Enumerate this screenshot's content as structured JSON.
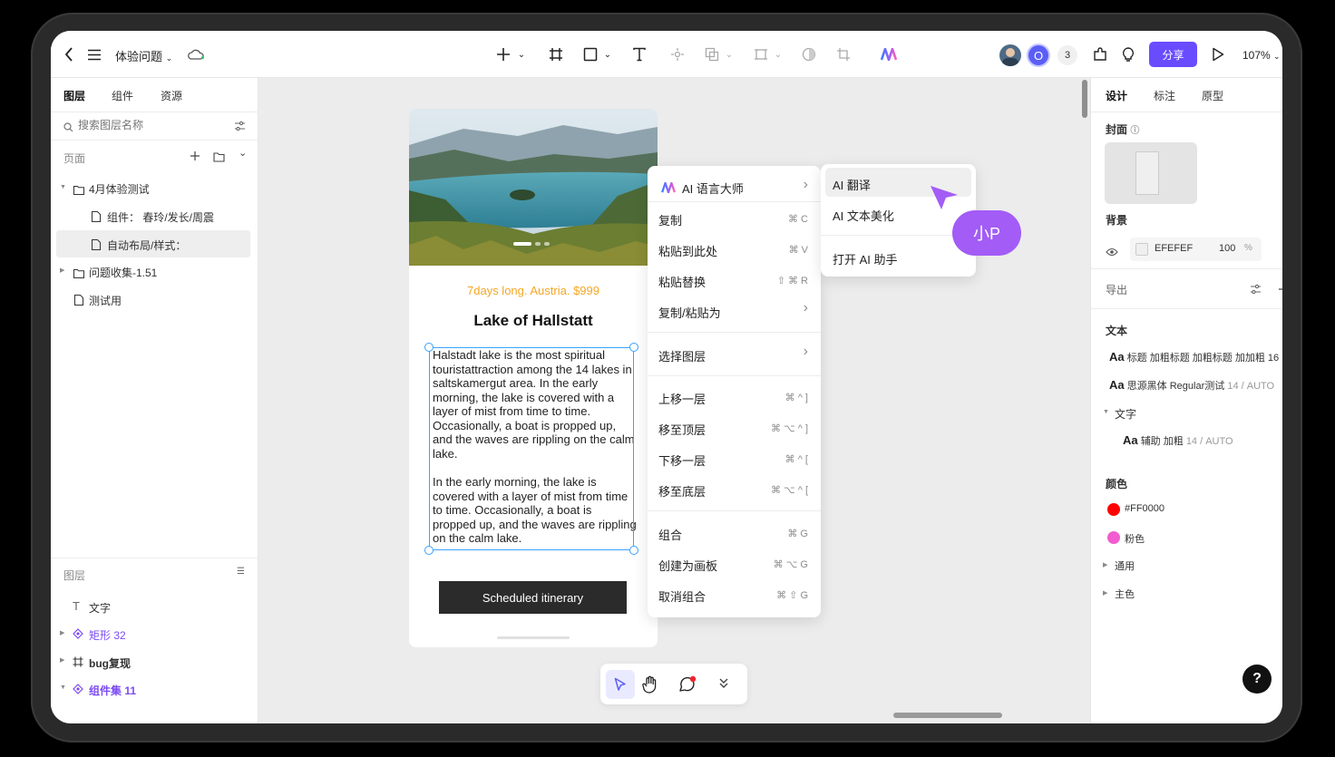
{
  "topbar": {
    "title": "体验问题",
    "collaborator_count": "3",
    "share_label": "分享",
    "zoom": "107%",
    "avatar_letter": "O"
  },
  "left_panel": {
    "tabs": [
      "图层",
      "组件",
      "资源"
    ],
    "search_placeholder": "搜索图层名称",
    "pages_label": "页面",
    "pages": [
      {
        "label": "4月体验测试"
      },
      {
        "label": "组件：  春玲/发长/周震"
      },
      {
        "label": "自动布局/样式："
      },
      {
        "label": "问题收集-1.51"
      },
      {
        "label": "测试用"
      }
    ],
    "layers_label": "图层",
    "layers": [
      {
        "label": "文字"
      },
      {
        "label": "矩形 32"
      },
      {
        "label": "bug复现"
      },
      {
        "label": "组件集 11"
      }
    ]
  },
  "right_panel": {
    "tabs": [
      "设计",
      "标注",
      "原型"
    ],
    "cover_label": "封面",
    "background_label": "背景",
    "background_hex": "EFEFEF",
    "background_opacity": "100",
    "percent": "%",
    "export_label": "导出",
    "text_label": "文本",
    "text_styles": [
      {
        "aa": "Aa",
        "label": "标题 加粗标题 加粗标题 加加粗 16"
      },
      {
        "aa": "Aa",
        "label": "思源黑体 Regular测试",
        "meta": "14 / AUTO"
      }
    ],
    "text_group": "文字",
    "text_sub": {
      "aa": "Aa",
      "label": "辅助 加粗",
      "meta": "14 / AUTO"
    },
    "color_label": "颜色",
    "colors": [
      {
        "label": "#FF0000",
        "hex": "#ff0000"
      },
      {
        "label": "粉色",
        "hex": "#f25ccf"
      }
    ],
    "color_groups": [
      "通用",
      "主色"
    ]
  },
  "card": {
    "subtitle": "7days long. Austria. $999",
    "title": "Lake of Hallstatt",
    "paragraph_1": "Halstadt lake is the most spiritual touristattraction among the 14 lakes in saltskamergut area. In the early morning, the lake is covered with a layer of mist from time to time. Occasionally, a boat is propped up, and the waves are rippling on the calm lake.",
    "paragraph_2": "In the early morning, the lake is covered with a layer of mist from time to time. Occasionally, a boat is propped up, and the waves are rippling on the calm lake.",
    "button_label": "Scheduled itinerary"
  },
  "context_menu": {
    "items": [
      {
        "label": "AI 语言大师",
        "shortcut": "›"
      },
      {
        "label": "复制",
        "shortcut": "⌘ C"
      },
      {
        "label": "粘贴到此处",
        "shortcut": "⌘ V"
      },
      {
        "label": "粘贴替换",
        "shortcut": "⇧ ⌘ R"
      },
      {
        "label": "复制/粘贴为",
        "shortcut": "›"
      },
      {
        "label": "选择图层",
        "shortcut": "›"
      },
      {
        "label": "上移一层",
        "shortcut": "⌘ ^ ]"
      },
      {
        "label": "移至顶层",
        "shortcut": "⌘ ⌥ ^ ]"
      },
      {
        "label": "下移一层",
        "shortcut": "⌘ ^ ["
      },
      {
        "label": "移至底层",
        "shortcut": "⌘ ⌥ ^ ["
      },
      {
        "label": "组合",
        "shortcut": "⌘ G"
      },
      {
        "label": "创建为画板",
        "shortcut": "⌘ ⌥ G"
      },
      {
        "label": "取消组合",
        "shortcut": "⌘ ⇧ G"
      }
    ]
  },
  "submenu": {
    "items": [
      {
        "label": "AI 翻译"
      },
      {
        "label": "AI 文本美化"
      },
      {
        "label": "打开 AI 助手"
      }
    ]
  },
  "cursor_badge": "小P",
  "help_label": "?"
}
